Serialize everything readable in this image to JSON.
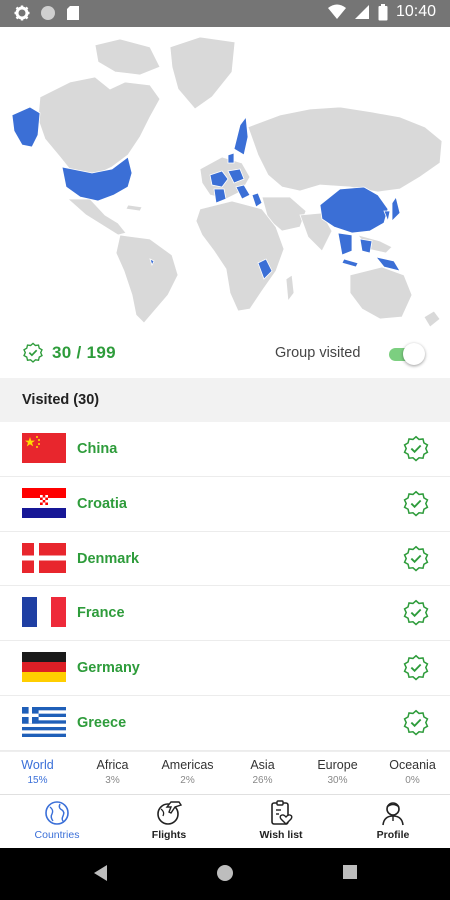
{
  "status_bar": {
    "time": "10:40",
    "left_icons": [
      "gear-icon",
      "circle-icon",
      "sd-card-icon"
    ],
    "right_icons": [
      "wifi-icon",
      "signal-icon",
      "battery-icon"
    ]
  },
  "map": {
    "visited_color": "#3b6fd6",
    "unvisited_color": "#d9d9d9"
  },
  "summary": {
    "count": "30 / 199",
    "group_label": "Group visited",
    "group_toggle_on": true
  },
  "section": {
    "title": "Visited (30)"
  },
  "countries": [
    {
      "name": "China",
      "flag": "flag-china-icon"
    },
    {
      "name": "Croatia",
      "flag": "flag-croatia-icon"
    },
    {
      "name": "Denmark",
      "flag": "flag-denmark-icon"
    },
    {
      "name": "France",
      "flag": "flag-france-icon"
    },
    {
      "name": "Germany",
      "flag": "flag-germany-icon"
    },
    {
      "name": "Greece",
      "flag": "flag-greece-icon"
    }
  ],
  "regions": [
    {
      "name": "World",
      "pct": "15%",
      "active": true
    },
    {
      "name": "Africa",
      "pct": "3%"
    },
    {
      "name": "Americas",
      "pct": "2%"
    },
    {
      "name": "Asia",
      "pct": "26%"
    },
    {
      "name": "Europe",
      "pct": "30%"
    },
    {
      "name": "Oceania",
      "pct": "0%"
    }
  ],
  "bottom_nav": [
    {
      "label": "Countries",
      "icon": "globe-icon",
      "active": true
    },
    {
      "label": "Flights",
      "icon": "plane-globe-icon"
    },
    {
      "label": "Wish list",
      "icon": "wishlist-icon"
    },
    {
      "label": "Profile",
      "icon": "profile-icon"
    }
  ],
  "colors": {
    "accent_green": "#2e9c3b",
    "accent_blue": "#3a6fd8"
  }
}
